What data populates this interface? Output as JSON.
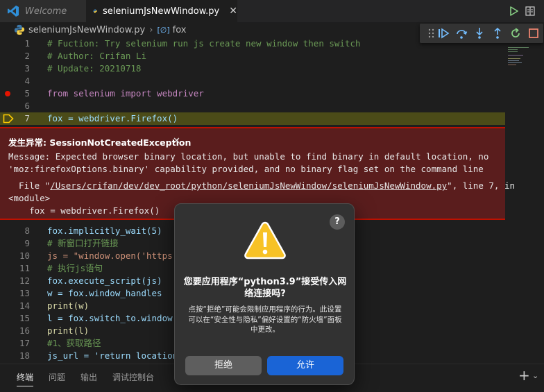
{
  "tabs": {
    "welcome": "Welcome",
    "active": "seleniumJsNewWindow.py",
    "close_glyph": "✕"
  },
  "breadcrumb": {
    "file": "seleniumJsNewWindow.py",
    "separator": "›",
    "symbol_icon": "[∅]",
    "symbol": "fox"
  },
  "code": {
    "lines": [
      {
        "n": "1",
        "text": "# Fuction: Try selenium run js create new window then switch"
      },
      {
        "n": "2",
        "text": "# Author: Crifan Li"
      },
      {
        "n": "3",
        "text": "# Update: 20210718"
      },
      {
        "n": "4",
        "text": ""
      },
      {
        "n": "5",
        "text": "from selenium import webdriver"
      },
      {
        "n": "6",
        "text": ""
      },
      {
        "n": "7",
        "text": "fox = webdriver.Firefox()"
      },
      {
        "n": "8",
        "text": "fox.implicitly_wait(5)"
      },
      {
        "n": "9",
        "text": "# 新窗口打开链接"
      },
      {
        "n": "10",
        "text": "js = \"window.open('https:"
      },
      {
        "n": "11",
        "text": "# 执行js语句"
      },
      {
        "n": "12",
        "text": "fox.execute_script(js)"
      },
      {
        "n": "13",
        "text": "w = fox.window_handles"
      },
      {
        "n": "14",
        "text": "print(w)"
      },
      {
        "n": "15",
        "text": "l = fox.switch_to.window(w"
      },
      {
        "n": "16",
        "text": "print(l)"
      },
      {
        "n": "17",
        "text": "#1、获取路径"
      },
      {
        "n": "18",
        "text": "js_url = 'return location"
      }
    ]
  },
  "exception": {
    "title": "发生异常: SessionNotCreatedException",
    "close_glyph": "✕",
    "message_1": "Message: Expected browser binary location, but unable to find binary in default location, no",
    "message_2": "'moz:firefoxOptions.binary' capability provided, and no binary flag set on the command line",
    "file_prefix": "  File \"",
    "file_path": "/Users/crifan/dev/dev_root/python/seleniumJsNewWindow/seleniumJsNewWindow.py",
    "file_suffix": "\", line 7, in",
    "module": "<module>",
    "code_line": "    fox = webdriver.Firefox()"
  },
  "panel": {
    "tabs": [
      "终端",
      "问题",
      "输出",
      "调试控制台"
    ],
    "active_tab": "终端",
    "add_glyph": "+",
    "chevron_glyph": "⌄"
  },
  "dialog": {
    "help": "?",
    "title": "您要应用程序“python3.9”接受传入网络连接吗?",
    "message": "点按“拒绝”可能会限制应用程序的行为。此设置可以在“安全性与隐私”偏好设置的“防火墙”面板中更改。",
    "deny_label": "拒绝",
    "allow_label": "允许"
  },
  "colors": {
    "accent_blue": "#1a64d6",
    "exception_bg": "#5a1d1d",
    "exception_border": "#be1100",
    "current_line": "#4b4b18",
    "breakpoint": "#e51400"
  }
}
